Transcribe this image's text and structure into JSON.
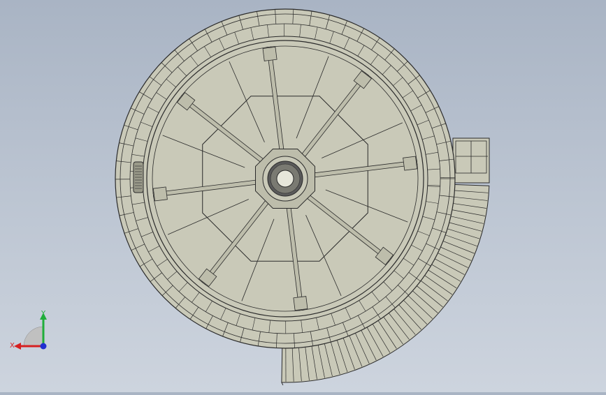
{
  "viewport": {
    "colors": {
      "model_fill": "#c9c9b8",
      "model_fill_dark": "#bdbdab",
      "edge": "#2a2a2a",
      "x_axis": "#d62020",
      "y_axis": "#1fae3a",
      "z_axis": "#2030d0"
    }
  },
  "triad": {
    "x_label": "X",
    "y_label": "Y"
  }
}
